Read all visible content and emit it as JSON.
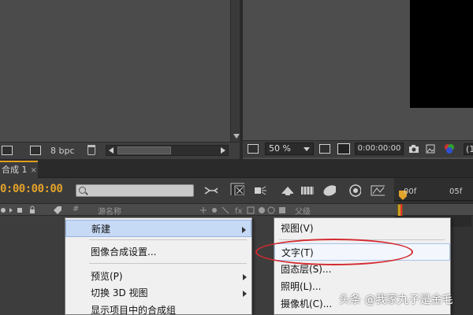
{
  "project_panel": {
    "bpc_label": "8 bpc"
  },
  "viewer": {
    "zoom_value": "50 %",
    "timecode": "0:00:00:00",
    "right_edge_text": "(1"
  },
  "timeline": {
    "tab_label": "合成 1",
    "tab_close": "×",
    "current_time": "0:00:00:00",
    "column_source_name": "源名称",
    "column_parent": "父级",
    "column_hash": "#",
    "ruler_ticks": [
      "00f",
      "05f"
    ]
  },
  "context_menu": {
    "items": [
      {
        "label": "新建",
        "has_submenu": true,
        "selected": true
      },
      {
        "label": "图像合成设置...",
        "has_submenu": false,
        "selected": false
      },
      {
        "label": "预览(P)",
        "has_submenu": true,
        "selected": false
      },
      {
        "label": "切换 3D 视图",
        "has_submenu": true,
        "selected": false
      },
      {
        "label": "显示项目中的合成组",
        "has_submenu": false,
        "selected": false
      }
    ]
  },
  "submenu": {
    "items": [
      {
        "label": "视图(V)",
        "highlighted": false
      },
      {
        "label": "文字(T)",
        "highlighted": true
      },
      {
        "label": "固态层(S)...",
        "highlighted": false
      },
      {
        "label": "照明(L)...",
        "highlighted": false
      },
      {
        "label": "摄像机(C)...",
        "highlighted": false
      }
    ]
  },
  "annotation": {
    "color": "#d42a30"
  },
  "watermark": "头条 @我家丸子是金毛",
  "colors": {
    "accent": "#e3a22a",
    "menu_selected": "#c6d9f5"
  }
}
